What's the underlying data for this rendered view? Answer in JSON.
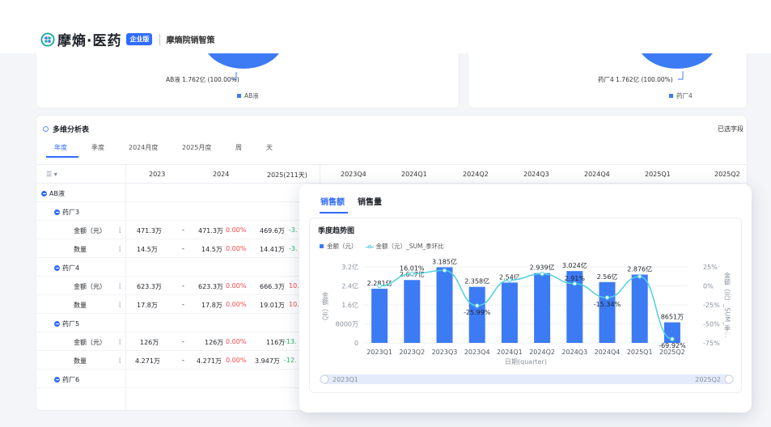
{
  "header": {
    "brand_name": "摩熵·医药",
    "brand_badge": "企业版",
    "product_name": "摩熵院销智策"
  },
  "pie_cards": [
    {
      "slice_label": "AB液 1.762亿 (100.00%)",
      "legend": "AB液"
    },
    {
      "slice_label": "药厂4 1.762亿 (100.00%)",
      "legend": "药厂4"
    }
  ],
  "table": {
    "title": "多维分析表",
    "selected_fields": "已选字段",
    "tabs": [
      "年度",
      "季度",
      "2024月度",
      "2025月度",
      "周",
      "天"
    ],
    "active_tab": "年度",
    "header_cols": [
      "2023",
      "2024",
      "2025(211天)",
      "2023Q4",
      "2024Q1",
      "2024Q2",
      "2024Q3",
      "2024Q4",
      "2025Q1",
      "2025Q2"
    ],
    "rows": [
      {
        "type": "group",
        "level": 0,
        "label": "AB液"
      },
      {
        "type": "group",
        "level": 1,
        "label": "药厂3"
      },
      {
        "type": "metric",
        "label": "金额（元）",
        "v2023": "471.3万",
        "dash": "-",
        "v2024": "471.3万",
        "p2024": "0.00%",
        "p2024_color": "red",
        "v2025": "469.6万",
        "p2025": "-3.",
        "p2025_color": "green"
      },
      {
        "type": "metric",
        "label": "数量",
        "v2023": "14.5万",
        "dash": "-",
        "v2024": "14.5万",
        "p2024": "0.00%",
        "p2024_color": "red",
        "v2025": "14.41万",
        "p2025": "-3.",
        "p2025_color": "green"
      },
      {
        "type": "group",
        "level": 1,
        "label": "药厂4"
      },
      {
        "type": "metric",
        "label": "金额（元）",
        "v2023": "623.3万",
        "dash": "-",
        "v2024": "623.3万",
        "p2024": "0.00%",
        "p2024_color": "red",
        "v2025": "666.3万",
        "p2025": "10.",
        "p2025_color": "red"
      },
      {
        "type": "metric",
        "label": "数量",
        "v2023": "17.8万",
        "dash": "-",
        "v2024": "17.8万",
        "p2024": "0.00%",
        "p2024_color": "red",
        "v2025": "19.01万",
        "p2025": "10.",
        "p2025_color": "red"
      },
      {
        "type": "group",
        "level": 1,
        "label": "药厂5"
      },
      {
        "type": "metric",
        "label": "金额（元）",
        "v2023": "126万",
        "dash": "-",
        "v2024": "126万",
        "p2024": "0.00%",
        "p2024_color": "red",
        "v2025": "116万",
        "p2025": "-13.",
        "p2025_color": "green"
      },
      {
        "type": "metric",
        "label": "数量",
        "v2023": "4.271万",
        "dash": "-",
        "v2024": "4.271万",
        "p2024": "0.00%",
        "p2024_color": "red",
        "v2025": "3.947万",
        "p2025": "-12.",
        "p2025_color": "green"
      },
      {
        "type": "group",
        "level": 1,
        "label": "药厂6"
      }
    ]
  },
  "popup": {
    "tabs": [
      "销售额",
      "销售量"
    ],
    "active_tab": "销售额",
    "chart_title": "季度趋势图",
    "legend_bar": "金额（元）",
    "legend_line": "金额（元）_SUM_季环比"
  },
  "chart_data": {
    "type": "bar",
    "title": "季度趋势图",
    "xlabel": "日期(quarter)",
    "ylabel": "金额（元）",
    "ylabel_right": "金额（元）_SUM_季...",
    "categories": [
      "2023Q1",
      "2023Q2",
      "2023Q3",
      "2023Q4",
      "2024Q1",
      "2024Q2",
      "2024Q3",
      "2024Q4",
      "2025Q1",
      "2025Q2"
    ],
    "series": [
      {
        "name": "金额（元）",
        "type": "bar",
        "values": [
          228100000,
          264700000,
          318500000,
          235800000,
          254000000,
          293900000,
          302400000,
          256000000,
          287600000,
          86510000
        ],
        "labels": [
          "2.281亿",
          "2.647亿",
          "3.185亿",
          "2.358亿",
          "2.54亿",
          "2.939亿",
          "3.024亿",
          "2.56亿",
          "2.876亿",
          "8651万"
        ]
      },
      {
        "name": "金额（元）_SUM_季环比",
        "type": "line",
        "values": [
          0,
          16.01,
          20.32,
          -25.99,
          7.72,
          15.71,
          2.91,
          -15.34,
          12.34,
          -69.92
        ],
        "labels": [
          "",
          "16.01%",
          "",
          "-25.99%",
          "",
          "",
          "2.91%",
          "-15.34%",
          "",
          "-69.92%"
        ]
      }
    ],
    "left_ticks": [
      "0",
      "8000万",
      "1.6亿",
      "2.4亿",
      "3.2亿"
    ],
    "right_ticks": [
      "-75%",
      "-50%",
      "-25%",
      "0%",
      "25%"
    ],
    "ylim": [
      0,
      320000000
    ],
    "ylim_right": [
      -75,
      25
    ],
    "range_slider": {
      "start": "2023Q1",
      "end": "2025Q2"
    },
    "colors": {
      "bar": "#3d7bf5",
      "line": "#4fd1dd"
    }
  }
}
